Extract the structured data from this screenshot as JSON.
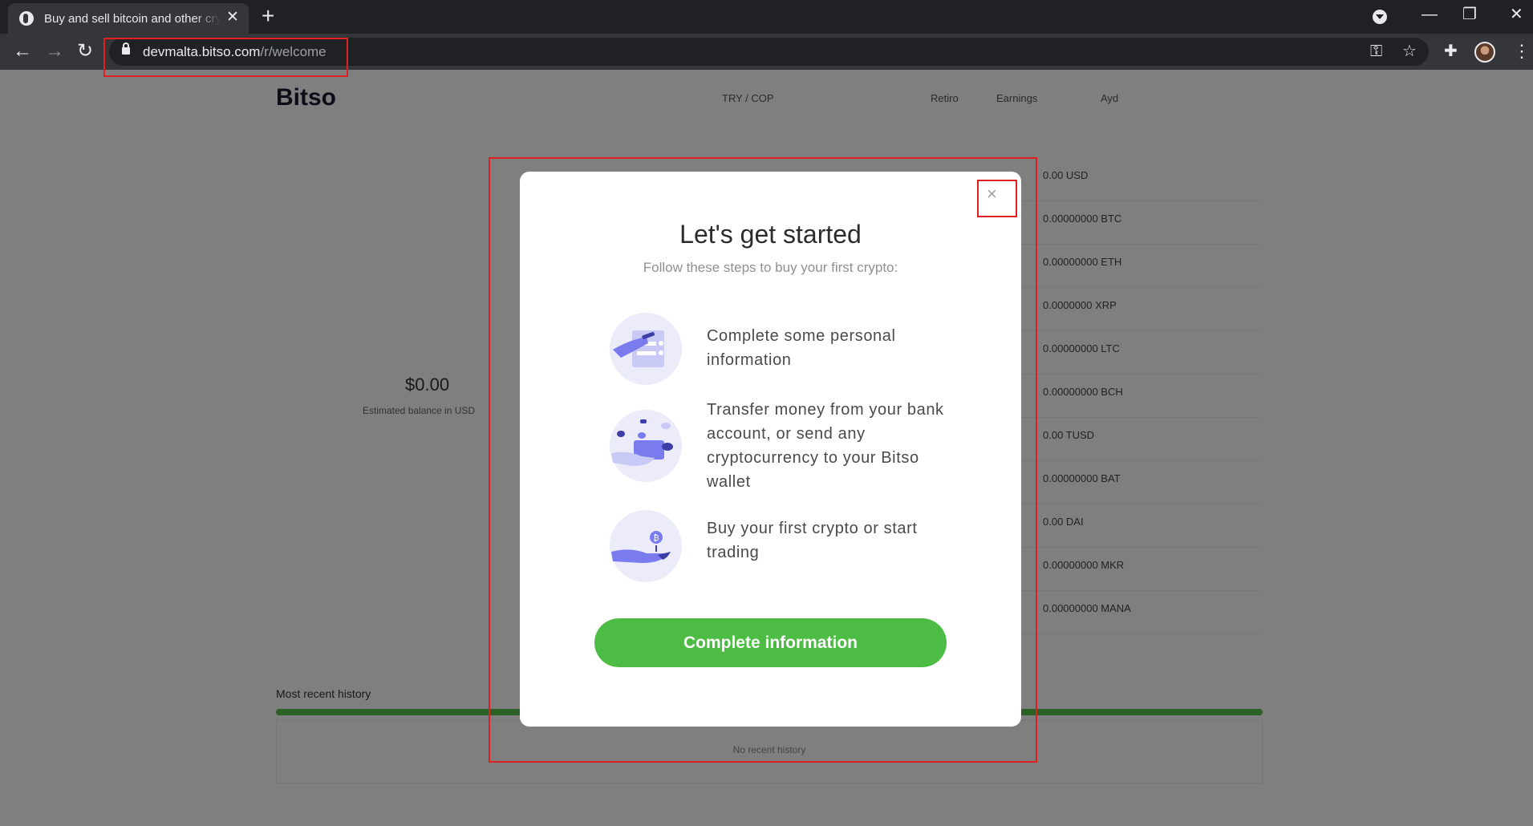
{
  "browser": {
    "tab_title": "Buy and sell bitcoin and other cryptocurrencies",
    "tab_close": "✕",
    "new_tab": "+",
    "url_host": "devmalta.bitso.com",
    "url_path": "/r/welcome",
    "icons": [
      "profile-menu-icon",
      "minimize-icon",
      "maximize-icon",
      "close-window-icon",
      "back-icon",
      "forward-icon",
      "reload-icon",
      "lock-icon",
      "key-icon",
      "star-icon",
      "puzzle-icon",
      "menu-icon"
    ]
  },
  "background": {
    "logo": "Bitso",
    "nav": [
      "TRY / COP",
      "Retiro",
      "Earnings",
      "Ayd"
    ],
    "balance": "$0.00",
    "balance_label": "Estimated balance in USD",
    "list_rows": [
      "0.00 USD",
      "0.00000000 BTC",
      "0.00000000 ETH",
      "0.0000000 XRP",
      "0.00000000 LTC",
      "0.00000000 BCH",
      "0.00 TUSD",
      "0.00000000 BAT",
      "0.00 DAI",
      "0.00000000 MKR",
      "0.00000000 MANA"
    ],
    "history_title": "Most recent history",
    "history_empty": "No recent history"
  },
  "modal": {
    "close": "×",
    "title": "Let's get started",
    "subtitle": "Follow these steps to buy your first crypto:",
    "steps": [
      {
        "text": "Complete some personal information",
        "icon": "personal-info-icon"
      },
      {
        "text": "Transfer money from your bank account, or send any cryptocurrency to your Bitso wallet",
        "icon": "transfer-money-icon"
      },
      {
        "text": "Buy your first crypto or start trading",
        "icon": "buy-crypto-icon"
      }
    ],
    "cta": "Complete information"
  },
  "colors": {
    "accent_green": "#4dbc45",
    "highlight_red": "#e02020",
    "illustration_purple": "#7b7bf0"
  }
}
